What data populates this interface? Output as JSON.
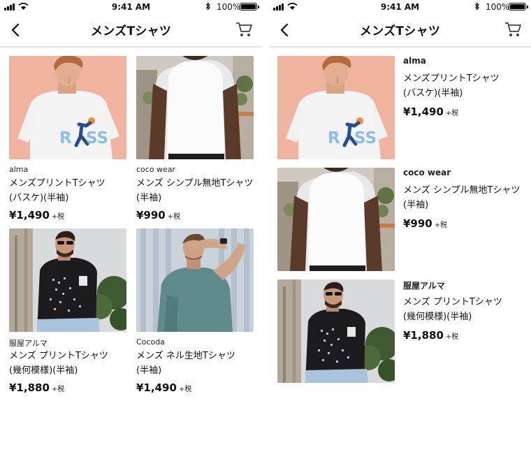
{
  "status_bar": {
    "time": "9:41 AM",
    "battery": "100%"
  },
  "header": {
    "title": "メンズTシャツ"
  },
  "colors": {
    "accent": "#111111",
    "divider": "#e6e6e6",
    "icon": "#444444"
  },
  "icons": {
    "back": "chevron-left-icon",
    "cart": "cart-icon"
  },
  "products": [
    {
      "brand": "alma",
      "name_line1": "メンズプリントTシャツ",
      "name_line2": "(バスケ)(半袖)",
      "price": "¥1,490",
      "tax": "+税",
      "print_text": "RISS"
    },
    {
      "brand": "coco wear",
      "name_line1": "メンズ シンプル無地Tシャツ",
      "name_line2": "(半袖)",
      "price": "¥990",
      "tax": "+税"
    },
    {
      "brand": "服屋アルマ",
      "name_line1": "メンズ プリントTシャツ",
      "name_line2": "(幾何模様)(半袖)",
      "price": "¥1,880",
      "tax": "+税"
    },
    {
      "brand": "Cocoda",
      "name_line1": "メンズ ネル生地Tシャツ",
      "name_line2": "(半袖)",
      "price": "¥1,490",
      "tax": "+税"
    }
  ]
}
